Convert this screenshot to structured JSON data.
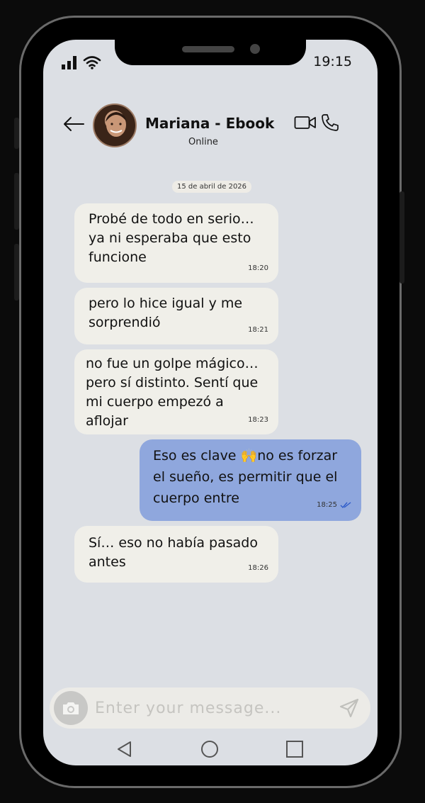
{
  "status_bar": {
    "time": "19:15"
  },
  "header": {
    "contact_name": "Mariana - Ebook",
    "contact_status": "Online"
  },
  "date_label": "15 de abril de 2026",
  "messages": [
    {
      "direction": "in",
      "text": "Probé de todo en serio… ya ni esperaba que esto funcione",
      "time": "18:20"
    },
    {
      "direction": "in",
      "text": "pero lo hice igual y me sorprendió",
      "time": "18:21"
    },
    {
      "direction": "in",
      "text": "no fue un golpe mágico… pero sí distinto. Sentí que mi cuerpo empezó a aflojar",
      "time": "18:23"
    },
    {
      "direction": "out",
      "text": "Eso es clave 🙌no es forzar el sueño, es permitir que el cuerpo entre",
      "time": "18:25",
      "read": true
    },
    {
      "direction": "in",
      "text": "Sí… eso no había pasado antes",
      "time": "18:26"
    }
  ],
  "composer": {
    "placeholder": "Enter your message..."
  },
  "colors": {
    "screen_bg": "#dcdfe4",
    "incoming_bubble": "#f0efe9",
    "outgoing_bubble": "#8fa7dd",
    "read_ticks": "#2d5bc9"
  },
  "icons": [
    "signal-icon",
    "wifi-icon",
    "back-arrow-icon",
    "video-camera-icon",
    "phone-icon",
    "camera-icon",
    "send-icon",
    "double-check-icon"
  ]
}
